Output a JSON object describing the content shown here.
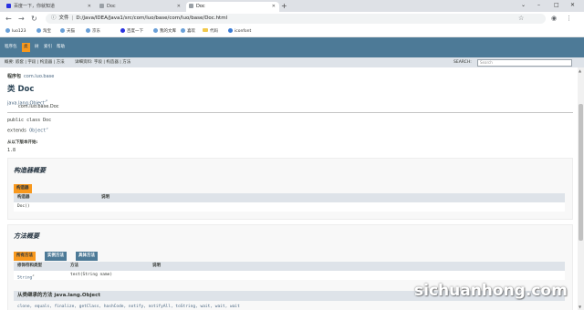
{
  "browser": {
    "tabs": [
      {
        "title": "百度一下，你就知道",
        "active": false
      },
      {
        "title": "Doc",
        "active": false
      },
      {
        "title": "Doc",
        "active": true
      }
    ],
    "new_tab": "+",
    "window_controls": [
      "⌄",
      "–",
      "□",
      "✕"
    ],
    "address": {
      "scheme_label": "文件",
      "url": "D:/Java/IDEA/Java1/src/com/luo/base/com/luo/base/Doc.html"
    },
    "bookmarks": [
      {
        "label": "luo123",
        "icon": "globe-icon"
      },
      {
        "label": "淘宝",
        "icon": "globe-icon"
      },
      {
        "label": "天猫",
        "icon": "globe-icon"
      },
      {
        "label": "京东",
        "icon": "globe-icon"
      },
      {
        "label": "百度一下",
        "icon": "paw-icon"
      },
      {
        "label": "我的文库",
        "icon": "globe-icon"
      },
      {
        "label": "喜欢",
        "icon": "globe-icon"
      },
      {
        "label": "代码",
        "icon": "folder-icon"
      },
      {
        "label": "iconfont",
        "icon": "globe-icon"
      }
    ]
  },
  "javadoc": {
    "navbar": {
      "items": [
        "程序包",
        "类",
        "树",
        "索引",
        "帮助"
      ],
      "active_index": 1
    },
    "subnav": {
      "left": "概要: 嵌套 | 字段 | 构造器 | 方法",
      "right": "详细资料: 字段 | 构造器 | 方法",
      "search_label": "SEARCH:",
      "search_placeholder": "Search"
    },
    "package_label": "程序包",
    "package_name": "com.luo.base",
    "class_title": "类 Doc",
    "inheritance": [
      "java.lang.Object",
      "com.luo.base.Doc"
    ],
    "declaration": {
      "line1": "public class Doc",
      "extends_kw": "extends ",
      "extends_link": "Object"
    },
    "since_label": "从以下版本开始:",
    "since_value": "1.8",
    "constructor_summary": {
      "title": "构造器概要",
      "caption": "构造器",
      "columns": [
        "构造器",
        "说明"
      ],
      "rows": [
        {
          "ctor": "Doc()",
          "desc": ""
        }
      ]
    },
    "method_summary": {
      "title": "方法概要",
      "tabs": [
        "所有方法",
        "实例方法",
        "具体方法"
      ],
      "active_tab": 0,
      "columns": [
        "修饰符和类型",
        "方法",
        "说明"
      ],
      "rows": [
        {
          "type": "String",
          "method": "test(String name)",
          "desc": ""
        }
      ]
    },
    "inherited": {
      "header": "从类继承的方法 java.lang.Object",
      "methods": "clone, equals, finalize, getClass, hashCode, notify, notifyAll, toString, wait, wait, wait"
    }
  },
  "watermark": "sichuanhong.com",
  "colors": {
    "navbar": "#4d7a97",
    "accent": "#f8981d",
    "subnav": "#dee3e9",
    "link": "#4a6782"
  }
}
